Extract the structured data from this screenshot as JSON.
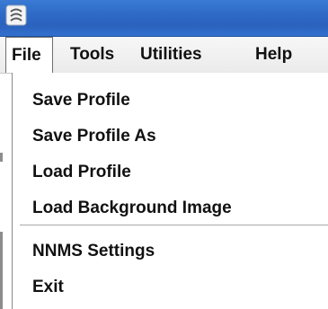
{
  "window": {
    "icon": "app-logo-icon"
  },
  "menubar": {
    "items": [
      {
        "label": "File"
      },
      {
        "label": "Tools"
      },
      {
        "label": "Utilities"
      },
      {
        "label": "Help"
      }
    ],
    "active": "File"
  },
  "file_menu": {
    "items": [
      {
        "label": "Save Profile"
      },
      {
        "label": "Save Profile As"
      },
      {
        "label": "Load Profile"
      },
      {
        "label": "Load Background Image"
      },
      {
        "label": "NNMS Settings"
      },
      {
        "label": "Exit"
      }
    ]
  },
  "colors": {
    "titlebar": "#2f6cc8",
    "menubar": "#efefef",
    "menu_text": "#111111"
  }
}
